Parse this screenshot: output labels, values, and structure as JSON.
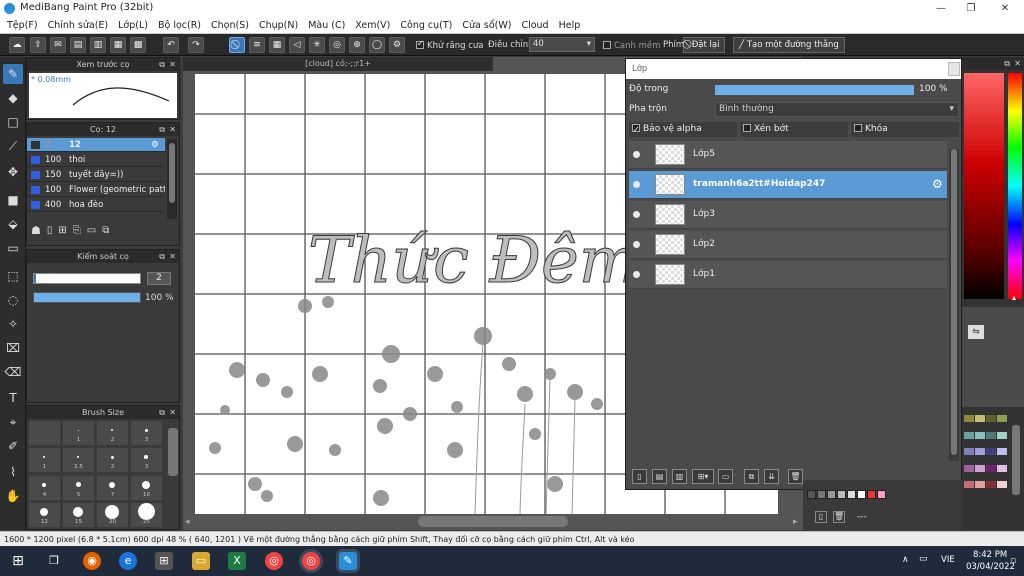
{
  "window": {
    "title": "MediBang Paint Pro (32bit)"
  },
  "menu": [
    "Tệp(F)",
    "Chỉnh sửa(E)",
    "Lớp(L)",
    "Bộ lọc(R)",
    "Chọn(S)",
    "Chụp(N)",
    "Màu (C)",
    "Xem(V)",
    "Công cụ(T)",
    "Cửa sổ(W)",
    "Cloud",
    "Help"
  ],
  "toolbar": {
    "antialias_label": "Khử răng cưa",
    "adjust_label": "Điều chỉnh",
    "adjust_value": "40",
    "smooth_edge_label": "Cạnh mềm",
    "key_label": "Phím",
    "reset_label": "Đặt lại",
    "line_label": "Tạo một đường thẳng"
  },
  "preview_panel": {
    "title": "Xem trước cọ",
    "size": "* 0.08mm"
  },
  "brush_panel": {
    "title": "Cọ: 12",
    "items": [
      {
        "size": "2",
        "name": "12",
        "selected": true
      },
      {
        "size": "100",
        "name": "thoi"
      },
      {
        "size": "150",
        "name": "tuyết dây=))"
      },
      {
        "size": "100",
        "name": "Flower (geometric patt"
      },
      {
        "size": "400",
        "name": "hoa đèo"
      }
    ]
  },
  "brush_control": {
    "title": "Kiểm soát cọ",
    "size_value": "2",
    "opacity_value": "100 %",
    "size_fraction": 0.02,
    "opacity_fraction": 1.0
  },
  "brush_size": {
    "title": "Brush Size",
    "labels": [
      "",
      "1",
      "2",
      "3",
      "1",
      "1.5",
      "2",
      "3",
      "4",
      "5",
      "7",
      "10",
      "12",
      "15",
      "20",
      "25"
    ]
  },
  "canvas": {
    "tab_title": "[cloud] cỏ;-;;r1+",
    "drawn_text": "Thức Đêm"
  },
  "layer_panel": {
    "title": "Lớp",
    "opacity_label": "Độ trong",
    "opacity_value": "100 %",
    "opacity_fraction": 1.0,
    "blend_label": "Pha trộn",
    "blend_value": "Bình thường",
    "protect_alpha_label": "Bảo vệ alpha",
    "clipping_label": "Xén bớt",
    "lock_label": "Khóa",
    "layers": [
      {
        "name": "Lớp5",
        "selected": false
      },
      {
        "name": "tramanh6a2tt#Hoidap247",
        "selected": true
      },
      {
        "name": "Lớp3",
        "selected": false
      },
      {
        "name": "Lớp2",
        "selected": false
      },
      {
        "name": "Lớp1",
        "selected": false
      }
    ]
  },
  "status_bar": {
    "text": "1600 * 1200 pixel  (6.8 * 5.1cm)  600 dpi  48 %  ( 640, 1201 )  Vẽ một đường thẳng bằng cách giữ phím Shift, Thay đổi cỡ cọ bằng cách giữ phím Ctrl, Alt và kéo"
  },
  "palette_bottom": {
    "label": "---"
  },
  "taskbar": {
    "language": "VIE",
    "time": "8:42 PM",
    "date": "03/04/2022"
  },
  "colors": {
    "accent": "#3a78b8",
    "layer_selected": "#5b9bd5",
    "bar": "#6fb0e8"
  }
}
